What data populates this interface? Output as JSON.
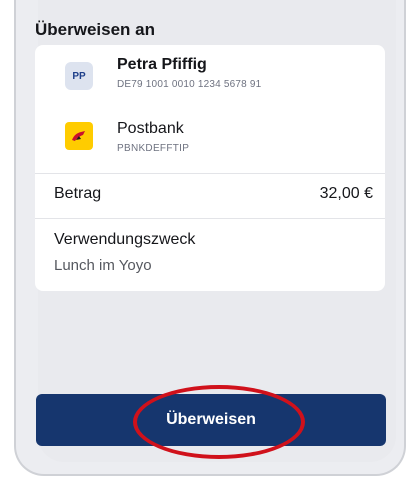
{
  "transfer": {
    "section_title": "Überweisen an",
    "recipient": {
      "initials": "PP",
      "name": "Petra Pfiffig",
      "iban": "DE79 1001 0010 1234 5678 91"
    },
    "bank": {
      "icon": "postbank-logo-icon",
      "name": "Postbank",
      "bic": "PBNKDEFFTIP"
    },
    "amount": {
      "label": "Betrag",
      "value": "32,00 €"
    },
    "purpose": {
      "label": "Verwendungszweck",
      "value": "Lunch im Yoyo"
    },
    "submit_label": "Überweisen"
  },
  "colors": {
    "primary": "#16366e",
    "annotation": "#d0111b",
    "bank_brand": "#ffcc00"
  }
}
